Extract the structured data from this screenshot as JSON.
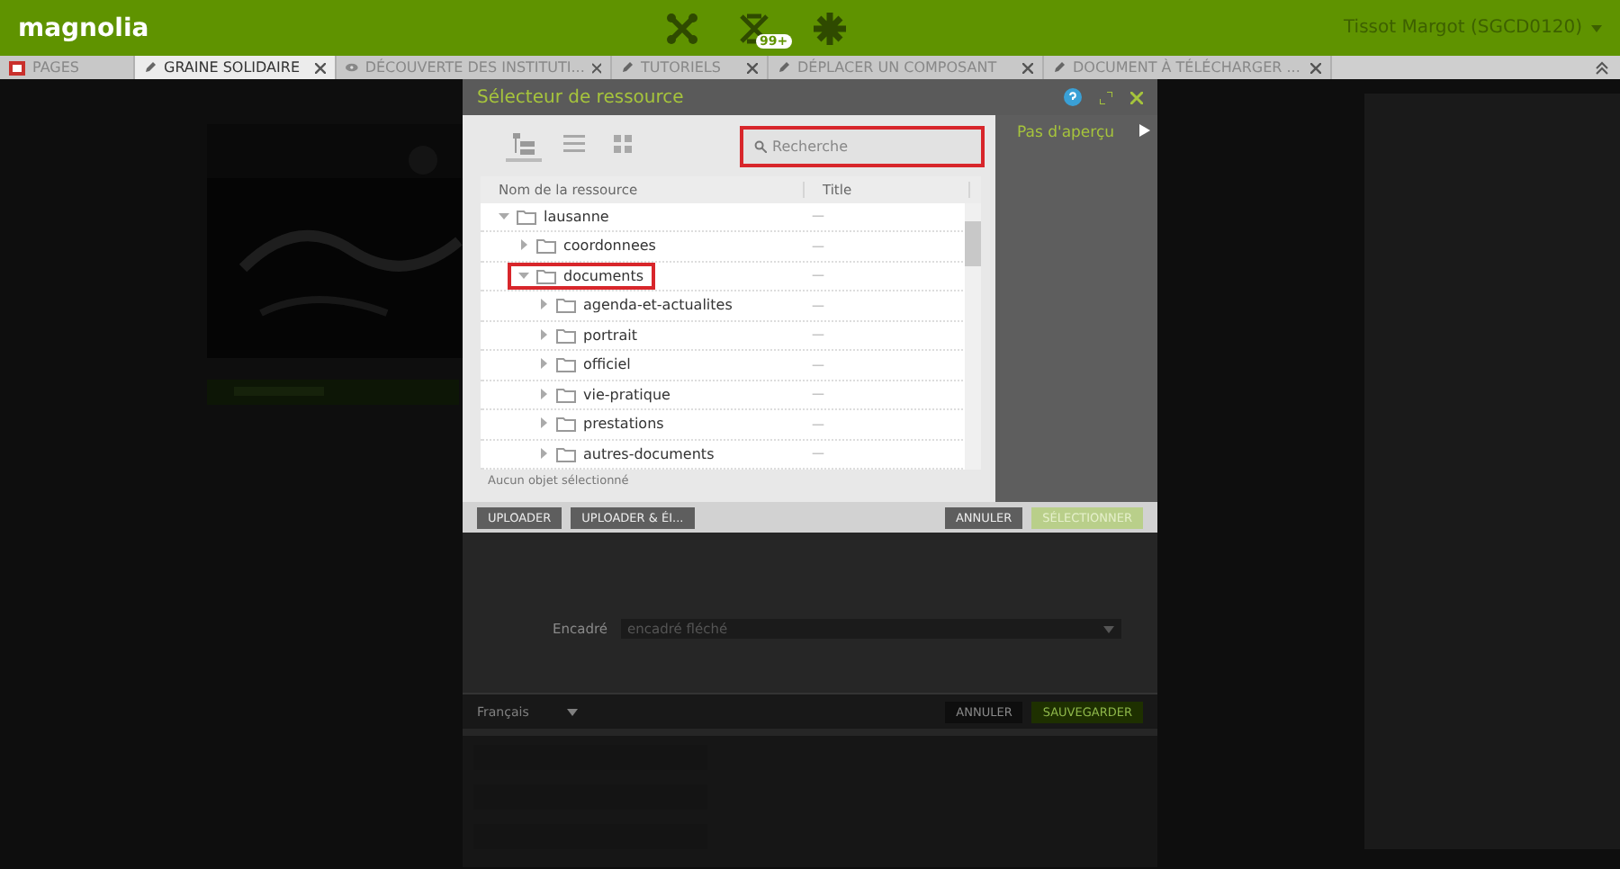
{
  "app_bar": {
    "logo": "magnolia",
    "notification_badge": "99+",
    "user": "Tissot Margot (SGCD0120)"
  },
  "tabs": [
    {
      "label": "PAGES",
      "kind": "app",
      "selected": false,
      "closable": false
    },
    {
      "label": "GRAINE SOLIDAIRE",
      "kind": "edit",
      "selected": true,
      "closable": true
    },
    {
      "label": "DÉCOUVERTE DES INSTITUTI...",
      "kind": "preview",
      "selected": false,
      "closable": true
    },
    {
      "label": "TUTORIELS",
      "kind": "edit",
      "selected": false,
      "closable": true
    },
    {
      "label": "DÉPLACER UN COMPOSANT",
      "kind": "edit",
      "selected": false,
      "closable": true
    },
    {
      "label": "DOCUMENT À TÉLÉCHARGER ...",
      "kind": "edit",
      "selected": false,
      "closable": true
    }
  ],
  "dialog": {
    "title": "Sélecteur de ressource",
    "views": [
      {
        "kind": "tree",
        "selected": true
      },
      {
        "kind": "list",
        "selected": false
      },
      {
        "kind": "thumbnails",
        "selected": false
      }
    ],
    "search": {
      "placeholder": "Recherche",
      "highlighted": true
    },
    "columns": [
      "Nom de la ressource",
      "Title"
    ],
    "tree": [
      {
        "name": "lausanne",
        "title": "—",
        "expanded": true,
        "highlighted": false,
        "children": [
          {
            "name": "coordonnees",
            "title": "—",
            "expanded": false,
            "highlighted": false
          },
          {
            "name": "documents",
            "title": "—",
            "expanded": true,
            "highlighted": true,
            "children": [
              {
                "name": "agenda-et-actualites",
                "title": "—",
                "expanded": false,
                "highlighted": false
              },
              {
                "name": "portrait",
                "title": "—",
                "expanded": false,
                "highlighted": false
              },
              {
                "name": "officiel",
                "title": "—",
                "expanded": false,
                "highlighted": false
              },
              {
                "name": "vie-pratique",
                "title": "—",
                "expanded": false,
                "highlighted": false
              },
              {
                "name": "prestations",
                "title": "—",
                "expanded": false,
                "highlighted": false
              },
              {
                "name": "autres-documents",
                "title": "—",
                "expanded": false,
                "highlighted": false
              }
            ]
          }
        ]
      }
    ],
    "status": "Aucun objet sélectionné",
    "preview": "Pas d'aperçu",
    "buttons": [
      {
        "label": "UPLOADER",
        "kind": "left",
        "disabled": false
      },
      {
        "label": "UPLOADER & ÉI...",
        "kind": "left",
        "disabled": false
      },
      {
        "label": "ANNULER",
        "kind": "right",
        "disabled": false
      },
      {
        "label": "SÉLECTIONNER",
        "kind": "right",
        "disabled": true
      }
    ]
  },
  "editor": {
    "field_label": "Encadré",
    "field_value": "encadré fléché",
    "language": "Français",
    "buttons": [
      {
        "label": "ANNULER",
        "kind": "cancel"
      },
      {
        "label": "SAUVEGARDER",
        "kind": "save"
      }
    ]
  }
}
